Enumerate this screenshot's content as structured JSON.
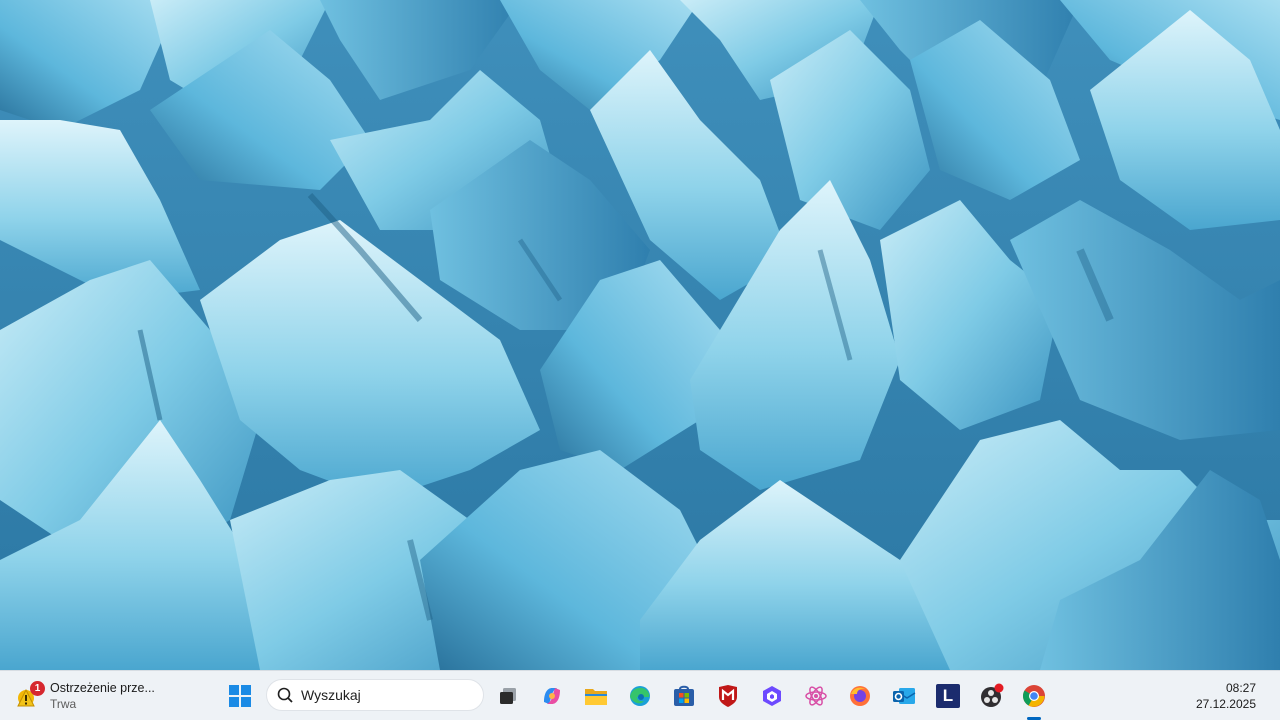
{
  "wallpaper": {
    "description_icon": "glacier-ice-wallpaper",
    "colors": [
      "#8fd3ea",
      "#5db7dc",
      "#2f89b8",
      "#1e5f86",
      "#b6e4f2"
    ]
  },
  "taskbar": {
    "weather": {
      "title": "Ostrzeżenie prze...",
      "subtitle": "Trwa",
      "badge": "1",
      "icon": "weather-warning-icon"
    },
    "search": {
      "label": "Wyszukaj",
      "icon": "search-icon"
    },
    "apps": [
      {
        "name": "windows-start-icon"
      },
      {
        "name": "task-view-icon"
      },
      {
        "name": "copilot-icon"
      },
      {
        "name": "file-explorer-icon"
      },
      {
        "name": "edge-icon"
      },
      {
        "name": "microsoft-store-icon"
      },
      {
        "name": "mcafee-icon"
      },
      {
        "name": "proton-vpn-icon"
      },
      {
        "name": "react-app-icon"
      },
      {
        "name": "firefox-icon"
      },
      {
        "name": "outlook-icon"
      },
      {
        "name": "l-app-icon",
        "letter": "L"
      },
      {
        "name": "obs-icon"
      },
      {
        "name": "chrome-icon",
        "active": true
      }
    ],
    "clock": {
      "time": "08:27",
      "date": "27.12.2025"
    },
    "accent": "#0067c0"
  }
}
